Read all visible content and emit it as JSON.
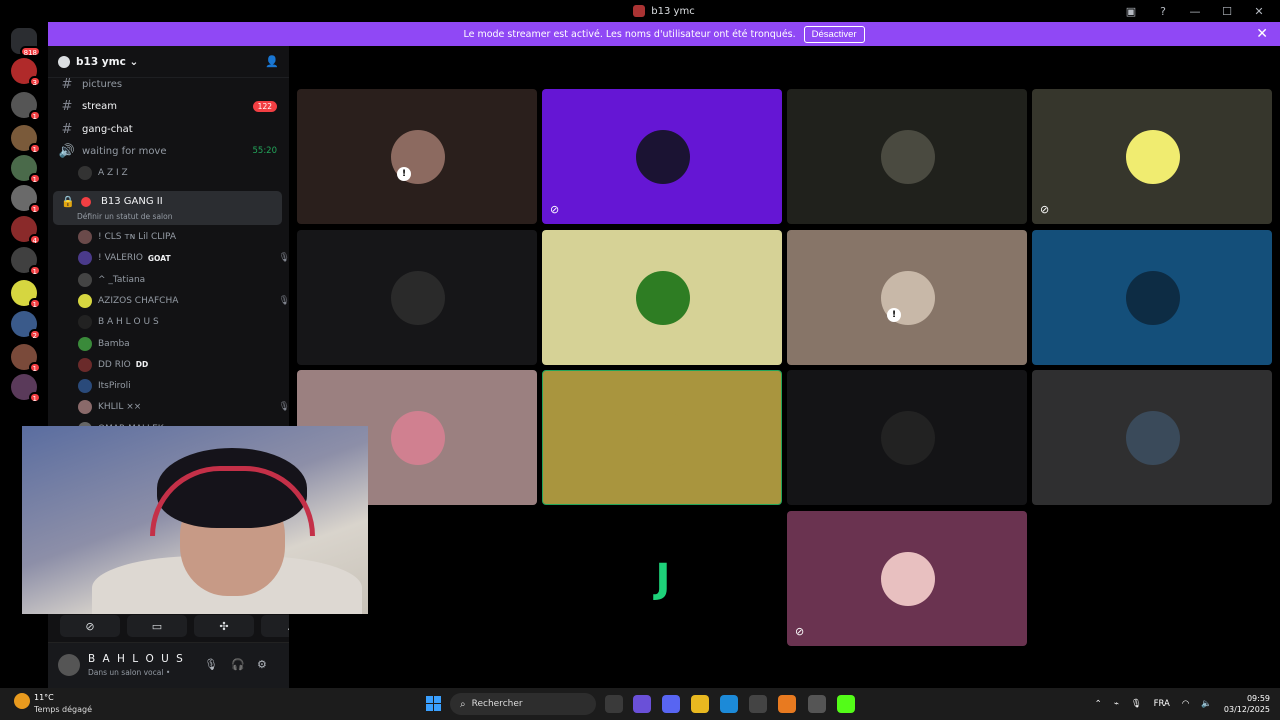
{
  "window": {
    "title": "b13 ymc"
  },
  "banner": {
    "message": "Le mode streamer est activé. Les noms d'utilisateur ont été tronqués.",
    "button": "Désactiver"
  },
  "guilds": [
    {
      "color": "#2b2d31",
      "badge": "818"
    },
    {
      "color": "#b02a2a",
      "badge": "3"
    },
    {
      "color": "#555",
      "badge": "1"
    },
    {
      "color": "#7a5a3a",
      "badge": "1"
    },
    {
      "color": "#4a6a4a",
      "badge": "1"
    },
    {
      "color": "#6a6a6a",
      "badge": "1"
    },
    {
      "color": "#8a2a2a",
      "badge": "4"
    },
    {
      "color": "#404040",
      "badge": "1"
    },
    {
      "color": "#d6d640",
      "badge": "1"
    },
    {
      "color": "#3a5a8a",
      "badge": "2"
    },
    {
      "color": "#7a4a3a",
      "badge": "1"
    },
    {
      "color": "#5a3a5a",
      "badge": "1"
    }
  ],
  "server": {
    "name": "b13 ymc"
  },
  "channels": {
    "pictures": "pictures",
    "stream": "stream",
    "stream_count": "122",
    "gangchat": "gang-chat",
    "waiting": "waiting for move",
    "waiting_time": "55:20",
    "waiting_member": "A Z I Z"
  },
  "voice_channel": {
    "name": "B13 GANG II",
    "status": "Définir un statut de salon"
  },
  "members": [
    {
      "name": "! CLS ᴛɴ Lil CLIPA",
      "color": "#6a4a4a",
      "icons": ""
    },
    {
      "name": "! VALERIO",
      "extra": "GOAT",
      "color": "#4a3a8a",
      "icons": "🎙 🎧"
    },
    {
      "name": "^ _Tatiana",
      "color": "#444",
      "icons": ""
    },
    {
      "name": "AZIZOS CHAFCHA",
      "color": "#d6d640",
      "icons": "🎙 🎧"
    },
    {
      "name": "B A H L O U S",
      "color": "#222",
      "icons": ""
    },
    {
      "name": "Bamba",
      "color": "#3a8a3a",
      "icons": ""
    },
    {
      "name": "DD RIO",
      "extra": "DD",
      "color": "#6a2a2a",
      "icons": ""
    },
    {
      "name": "ItsPiroli",
      "color": "#2a4a7a",
      "icons": ""
    },
    {
      "name": "KHLIL ××",
      "color": "#8a6a6a",
      "icons": "🎙 🎧"
    },
    {
      "name": "OMAR MALLEK",
      "color": "#666",
      "icons": ""
    }
  ],
  "user": {
    "name": "B A H L O U S",
    "status": "Dans un salon vocal •"
  },
  "tiles": [
    {
      "bg": "#2a1f1c",
      "av": "#8c6a60",
      "muted": false,
      "warn": true
    },
    {
      "bg": "#6516d4",
      "av": "#1b1333",
      "muted": true,
      "warn": false
    },
    {
      "bg": "#20211c",
      "av": "#4a4a40",
      "muted": false,
      "warn": false
    },
    {
      "bg": "#36362c",
      "av": "#f0ec70",
      "muted": true,
      "warn": false
    },
    {
      "bg": "#161618",
      "av": "#2a2a2a",
      "muted": false,
      "warn": false
    },
    {
      "bg": "#d6d296",
      "av": "#2e7d23",
      "muted": false,
      "warn": false
    },
    {
      "bg": "#877568",
      "av": "#c8b8a8",
      "muted": false,
      "warn": true
    },
    {
      "bg": "#144f7a",
      "av": "#0d2c44",
      "muted": false,
      "warn": false
    },
    {
      "bg": "#9b8080",
      "av": "#d08090",
      "muted": false,
      "warn": false
    },
    {
      "bg": "#a9953e",
      "av": "#a9953e",
      "muted": false,
      "warn": false
    },
    {
      "bg": "#141416",
      "av": "#222",
      "muted": false,
      "warn": false
    },
    {
      "bg": "#2f2f30",
      "av": "#3a4a5a",
      "muted": false,
      "warn": false
    },
    {
      "bg": "#000000",
      "av": "#000000",
      "muted": false,
      "warn": false,
      "glyph": "J"
    },
    {
      "bg": "#6a3350",
      "av": "#e8c0c0",
      "muted": true,
      "warn": false
    }
  ],
  "taskbar": {
    "temp": "11°C",
    "condition": "Temps dégagé",
    "search": "Rechercher",
    "lang": "FRA",
    "time": "09:59",
    "date": "03/12/2025"
  }
}
